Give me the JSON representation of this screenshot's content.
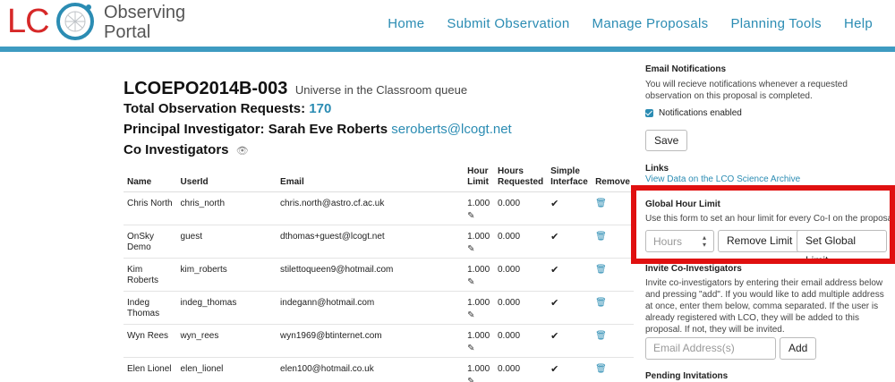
{
  "header": {
    "logo_letters": "LC",
    "logo_text_line1": "Observing",
    "logo_text_line2": "Portal",
    "nav": [
      "Home",
      "Submit Observation",
      "Manage Proposals",
      "Planning Tools",
      "Help"
    ]
  },
  "proposal": {
    "id": "LCOEPO2014B-003",
    "name": "Universe in the Classroom queue",
    "total_label": "Total Observation Requests:",
    "total_count": "170",
    "pi_label": "Principal Investigator: Sarah Eve Roberts",
    "pi_email": "seroberts@lcogt.net",
    "coi_label": "Co Investigators"
  },
  "table": {
    "headers": {
      "name": "Name",
      "userid": "UserId",
      "email": "Email",
      "hour_limit": "Hour Limit",
      "hours_requested": "Hours Requested",
      "simple_interface": "Simple Interface",
      "remove": "Remove"
    },
    "rows": [
      {
        "name": "Chris North",
        "userid": "chris_north",
        "email": "chris.north@astro.cf.ac.uk",
        "limit": "1.000",
        "requested": "0.000"
      },
      {
        "name": "OnSky Demo",
        "userid": "guest",
        "email": "dthomas+guest@lcogt.net",
        "limit": "1.000",
        "requested": "0.000"
      },
      {
        "name": "Kim Roberts",
        "userid": "kim_roberts",
        "email": "stilettoqueen9@hotmail.com",
        "limit": "1.000",
        "requested": "0.000"
      },
      {
        "name": "Indeg Thomas",
        "userid": "indeg_thomas",
        "email": "indegann@hotmail.com",
        "limit": "1.000",
        "requested": "0.000"
      },
      {
        "name": "Wyn Rees",
        "userid": "wyn_rees",
        "email": "wyn1969@btinternet.com",
        "limit": "1.000",
        "requested": "0.000"
      },
      {
        "name": "Elen Lionel",
        "userid": "elen_lionel",
        "email": "elen100@hotmail.co.uk",
        "limit": "1.000",
        "requested": "0.000"
      }
    ]
  },
  "sidebar": {
    "email_notifications": {
      "title": "Email Notifications",
      "desc": "You will recieve notifications whenever a requested observation on this proposal is completed.",
      "checkbox_label": "Notifications enabled",
      "save": "Save"
    },
    "links": {
      "title": "Links",
      "archive": "View Data on the LCO Science Archive"
    },
    "global_limit": {
      "title": "Global Hour Limit",
      "desc": "Use this form to set an hour limit for every Co-I on the proposal.",
      "hours_placeholder": "Hours",
      "remove": "Remove Limit",
      "set": "Set Global Limit"
    },
    "invite": {
      "title": "Invite Co-Investigators",
      "desc": "Invite co-investigators by entering their email address below and pressing \"add\". If you would like to add multiple address at once, enter them below, comma separated. If the user is already registered with LCO, they will be added to this proposal. If not, they will be invited.",
      "email_placeholder": "Email Address(s)",
      "add": "Add"
    },
    "pending": {
      "title": "Pending Invitations"
    }
  },
  "colors": {
    "accent": "#2b8cb3",
    "logo_red": "#d62828",
    "highlight": "#e01010",
    "nav_bar": "#3e9bc1"
  }
}
